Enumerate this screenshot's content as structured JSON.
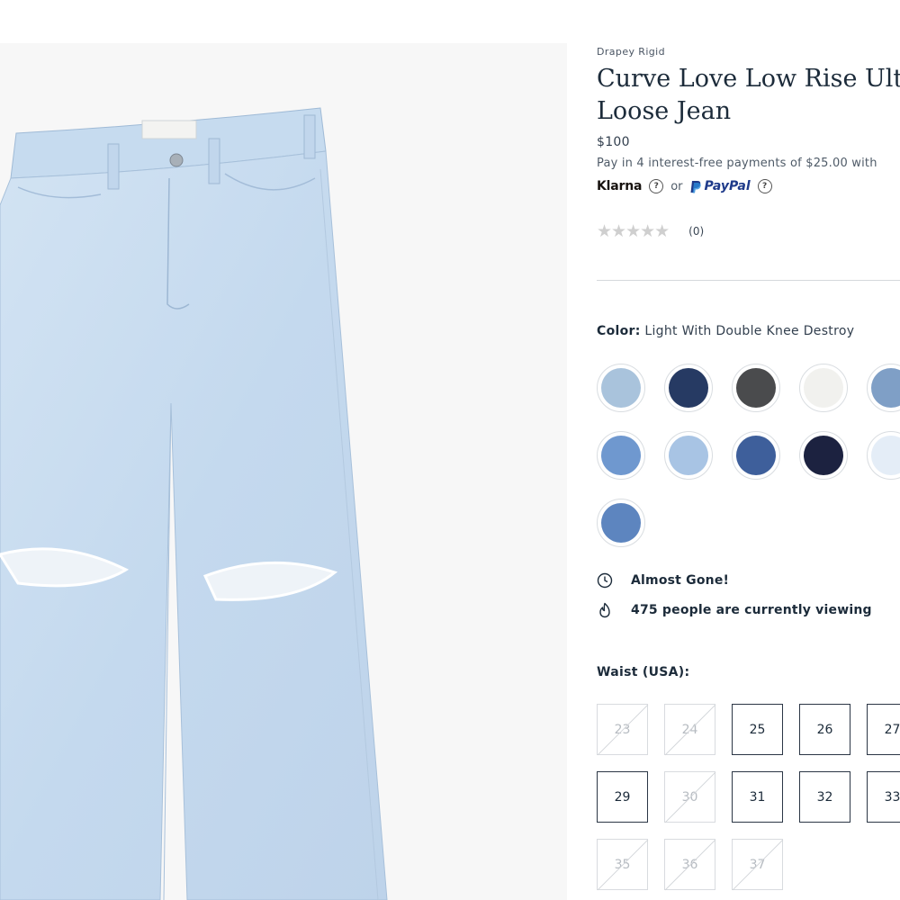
{
  "product": {
    "collection": "Drapey Rigid",
    "title": "Curve Love Low Rise Ultra Loose Jean",
    "price": "$100",
    "installments": "Pay in 4 interest-free payments of $25.00 with",
    "klarna": "Klarna",
    "help_glyph": "?",
    "or": "or",
    "paypal": "PayPal",
    "stars": "★★★★★",
    "rating_value": 0,
    "rating_count": "(0)"
  },
  "color": {
    "label": "Color:",
    "selected": "Light With Double Knee Destroy",
    "swatches": [
      {
        "hex": "#a9c3dc"
      },
      {
        "hex": "#263a63"
      },
      {
        "hex": "#4a4b4d"
      },
      {
        "hex": "#f1f1ee"
      },
      {
        "hex": "#7f9fc6"
      },
      {
        "hex": "#6f98cf"
      },
      {
        "hex": "#a8c4e4"
      },
      {
        "hex": "#3e5f9b"
      },
      {
        "hex": "#1c2240"
      },
      {
        "hex": "#e4edf7"
      },
      {
        "hex": "#5d85bf"
      }
    ]
  },
  "status": {
    "almost_gone": "Almost Gone!",
    "icon1": "clock-icon",
    "viewers": "475 people are currently viewing",
    "icon2": "flame-icon"
  },
  "waist": {
    "label": "Waist (USA):",
    "sizes": [
      {
        "label": "23",
        "available": false
      },
      {
        "label": "24",
        "available": false
      },
      {
        "label": "25",
        "available": true
      },
      {
        "label": "26",
        "available": true
      },
      {
        "label": "27",
        "available": true
      },
      {
        "label": "29",
        "available": true
      },
      {
        "label": "30",
        "available": false
      },
      {
        "label": "31",
        "available": true
      },
      {
        "label": "32",
        "available": true
      },
      {
        "label": "33",
        "available": true
      },
      {
        "label": "35",
        "available": false
      },
      {
        "label": "36",
        "available": false
      },
      {
        "label": "37",
        "available": false
      }
    ]
  },
  "colors": {
    "text": "#1c2b3a",
    "denim": "#c9dcee",
    "paypal": "#1e3a8a"
  }
}
